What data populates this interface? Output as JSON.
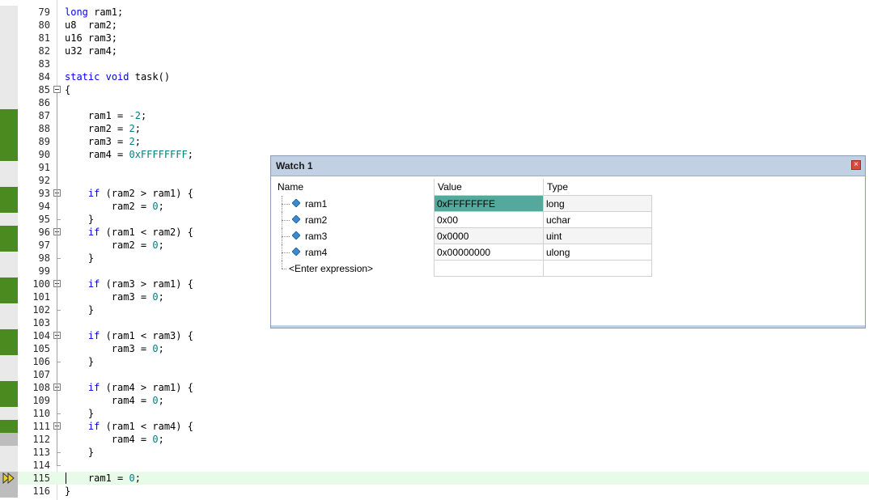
{
  "editor": {
    "lines": [
      {
        "n": "79",
        "code": [
          [
            "long",
            "kw"
          ],
          [
            " ram1;",
            ""
          ]
        ],
        "cov": "none"
      },
      {
        "n": "80",
        "code": [
          [
            "u8  ram2;",
            ""
          ]
        ],
        "cov": "none"
      },
      {
        "n": "81",
        "code": [
          [
            "u16 ram3;",
            ""
          ]
        ],
        "cov": "none"
      },
      {
        "n": "82",
        "code": [
          [
            "u32 ram4;",
            ""
          ]
        ],
        "cov": "none"
      },
      {
        "n": "83",
        "code": [],
        "cov": "none"
      },
      {
        "n": "84",
        "code": [
          [
            "static",
            "kw"
          ],
          [
            " ",
            ""
          ],
          [
            "void",
            "kw"
          ],
          [
            " task()",
            ""
          ]
        ],
        "cov": "none"
      },
      {
        "n": "85",
        "code": [
          [
            "{",
            ""
          ]
        ],
        "cov": "none",
        "fold": "start"
      },
      {
        "n": "86",
        "code": [],
        "cov": "none"
      },
      {
        "n": "87",
        "code": [
          [
            "    ram1 = ",
            ""
          ],
          [
            "-2",
            "num"
          ],
          [
            ";",
            ""
          ]
        ],
        "cov": "executed"
      },
      {
        "n": "88",
        "code": [
          [
            "    ram2 = ",
            ""
          ],
          [
            "2",
            "num"
          ],
          [
            ";",
            ""
          ]
        ],
        "cov": "executed"
      },
      {
        "n": "89",
        "code": [
          [
            "    ram3 = ",
            ""
          ],
          [
            "2",
            "num"
          ],
          [
            ";",
            ""
          ]
        ],
        "cov": "executed"
      },
      {
        "n": "90",
        "code": [
          [
            "    ram4 = ",
            ""
          ],
          [
            "0xFFFFFFFF",
            "num"
          ],
          [
            ";",
            ""
          ]
        ],
        "cov": "executed"
      },
      {
        "n": "91",
        "code": [],
        "cov": "none"
      },
      {
        "n": "92",
        "code": [],
        "cov": "none"
      },
      {
        "n": "93",
        "code": [
          [
            "    ",
            ""
          ],
          [
            "if",
            "kw"
          ],
          [
            " (ram2 > ram1) {",
            ""
          ]
        ],
        "cov": "executed",
        "fold": "start"
      },
      {
        "n": "94",
        "code": [
          [
            "        ram2 = ",
            ""
          ],
          [
            "0",
            "num"
          ],
          [
            ";",
            ""
          ]
        ],
        "cov": "executed"
      },
      {
        "n": "95",
        "code": [
          [
            "    }",
            ""
          ]
        ],
        "cov": "none",
        "fold": "end"
      },
      {
        "n": "96",
        "code": [
          [
            "    ",
            ""
          ],
          [
            "if",
            "kw"
          ],
          [
            " (ram1 < ram2) {",
            ""
          ]
        ],
        "cov": "executed",
        "fold": "start"
      },
      {
        "n": "97",
        "code": [
          [
            "        ram2 = ",
            ""
          ],
          [
            "0",
            "num"
          ],
          [
            ";",
            ""
          ]
        ],
        "cov": "executed"
      },
      {
        "n": "98",
        "code": [
          [
            "    }",
            ""
          ]
        ],
        "cov": "none",
        "fold": "end"
      },
      {
        "n": "99",
        "code": [],
        "cov": "none"
      },
      {
        "n": "100",
        "code": [
          [
            "    ",
            ""
          ],
          [
            "if",
            "kw"
          ],
          [
            " (ram3 > ram1) {",
            ""
          ]
        ],
        "cov": "executed",
        "fold": "start"
      },
      {
        "n": "101",
        "code": [
          [
            "        ram3 = ",
            ""
          ],
          [
            "0",
            "num"
          ],
          [
            ";",
            ""
          ]
        ],
        "cov": "executed"
      },
      {
        "n": "102",
        "code": [
          [
            "    }",
            ""
          ]
        ],
        "cov": "none",
        "fold": "end"
      },
      {
        "n": "103",
        "code": [],
        "cov": "none"
      },
      {
        "n": "104",
        "code": [
          [
            "    ",
            ""
          ],
          [
            "if",
            "kw"
          ],
          [
            " (ram1 < ram3) {",
            ""
          ]
        ],
        "cov": "executed",
        "fold": "start"
      },
      {
        "n": "105",
        "code": [
          [
            "        ram3 = ",
            ""
          ],
          [
            "0",
            "num"
          ],
          [
            ";",
            ""
          ]
        ],
        "cov": "executed"
      },
      {
        "n": "106",
        "code": [
          [
            "    }",
            ""
          ]
        ],
        "cov": "none",
        "fold": "end"
      },
      {
        "n": "107",
        "code": [],
        "cov": "none"
      },
      {
        "n": "108",
        "code": [
          [
            "    ",
            ""
          ],
          [
            "if",
            "kw"
          ],
          [
            " (ram4 > ram1) {",
            ""
          ]
        ],
        "cov": "executed",
        "fold": "start"
      },
      {
        "n": "109",
        "code": [
          [
            "        ram4 = ",
            ""
          ],
          [
            "0",
            "num"
          ],
          [
            ";",
            ""
          ]
        ],
        "cov": "executed"
      },
      {
        "n": "110",
        "code": [
          [
            "    }",
            ""
          ]
        ],
        "cov": "none",
        "fold": "end"
      },
      {
        "n": "111",
        "code": [
          [
            "    ",
            ""
          ],
          [
            "if",
            "kw"
          ],
          [
            " (ram1 < ram4) {",
            ""
          ]
        ],
        "cov": "executed",
        "fold": "start"
      },
      {
        "n": "112",
        "code": [
          [
            "        ram4 = ",
            ""
          ],
          [
            "0",
            "num"
          ],
          [
            ";",
            ""
          ]
        ],
        "cov": "partial"
      },
      {
        "n": "113",
        "code": [
          [
            "    }",
            ""
          ]
        ],
        "cov": "none",
        "fold": "end"
      },
      {
        "n": "114",
        "code": [],
        "cov": "none",
        "fold": "end"
      },
      {
        "n": "115",
        "code": [
          [
            "    ram1 = ",
            ""
          ],
          [
            "0",
            "num"
          ],
          [
            ";",
            ""
          ]
        ],
        "cov": "partial",
        "current": true
      },
      {
        "n": "116",
        "code": [
          [
            "}",
            ""
          ]
        ],
        "cov": "partial"
      }
    ]
  },
  "watch": {
    "title": "Watch 1",
    "close_glyph": "×",
    "columns": {
      "name": "Name",
      "value": "Value",
      "type": "Type"
    },
    "rows": [
      {
        "name": "ram1",
        "value": "0xFFFFFFFE",
        "type": "long",
        "changed": true
      },
      {
        "name": "ram2",
        "value": "0x00",
        "type": "uchar",
        "changed": false
      },
      {
        "name": "ram3",
        "value": "0x0000",
        "type": "uint",
        "changed": false
      },
      {
        "name": "ram4",
        "value": "0x00000000",
        "type": "ulong",
        "changed": false
      }
    ],
    "enter_expression": "<Enter expression>"
  },
  "colors": {
    "coverage_executed": "#4a8a1e",
    "coverage_partial": "#bdbdbd",
    "current_line": "#e8fbe8",
    "keyword": "#0000ff",
    "number": "#008080",
    "changed_value": "#55a89c",
    "watch_titlebar": "#c2d0e4"
  },
  "icons": {
    "execution_pointer": "yellow-arrow-icon",
    "variable": "variable-diamond-icon"
  }
}
